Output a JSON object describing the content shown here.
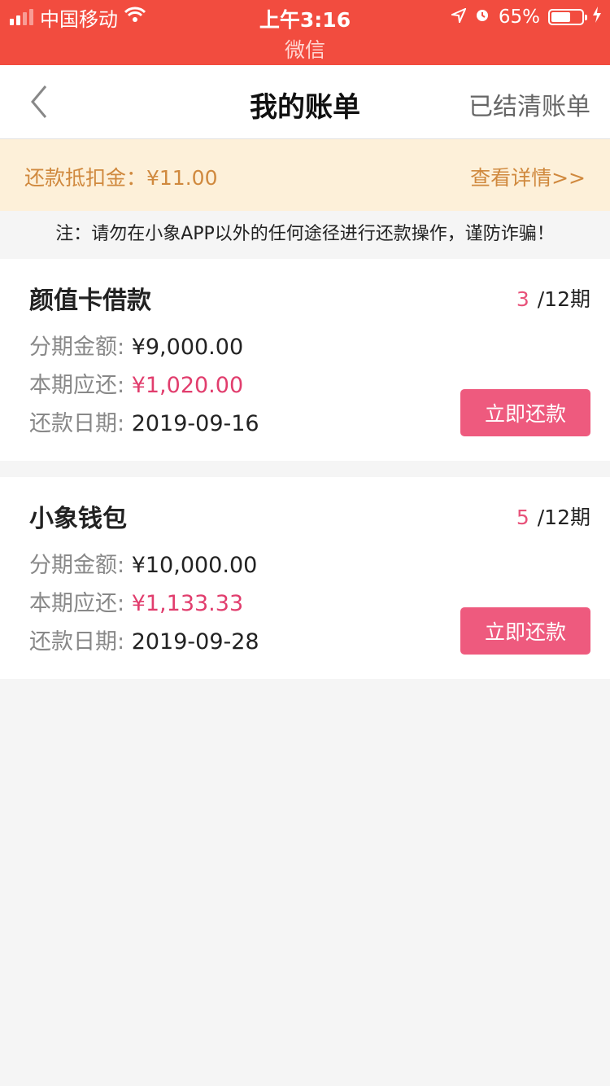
{
  "status_bar": {
    "carrier": "中国移动",
    "time": "上午3:16",
    "app_name": "微信",
    "battery_percent": "65%",
    "battery_level": 0.65
  },
  "nav": {
    "title": "我的账单",
    "right_link": "已结清账单"
  },
  "deduction": {
    "label": "还款抵扣金：¥11.00",
    "link": "查看详情>>"
  },
  "notice": "注：请勿在小象APP以外的任何途径进行还款操作，谨防诈骗！",
  "bills": [
    {
      "name": "颜值卡借款",
      "current_period": "3",
      "total_periods": "/12期",
      "amount_label": "分期金额:",
      "amount": "¥9,000.00",
      "due_label": "本期应还:",
      "due": "¥1,020.00",
      "date_label": "还款日期:",
      "date": "2019-09-16",
      "pay_label": "立即还款"
    },
    {
      "name": "小象钱包",
      "current_period": "5",
      "total_periods": "/12期",
      "amount_label": "分期金额:",
      "amount": "¥10,000.00",
      "due_label": "本期应还:",
      "due": "¥1,133.33",
      "date_label": "还款日期:",
      "date": "2019-09-28",
      "pay_label": "立即还款"
    }
  ],
  "colors": {
    "status_bar": "#f24c3f",
    "accent_pink": "#ee5a7e",
    "deduction_bg": "#fdf0d9",
    "deduction_text": "#d0893e"
  }
}
